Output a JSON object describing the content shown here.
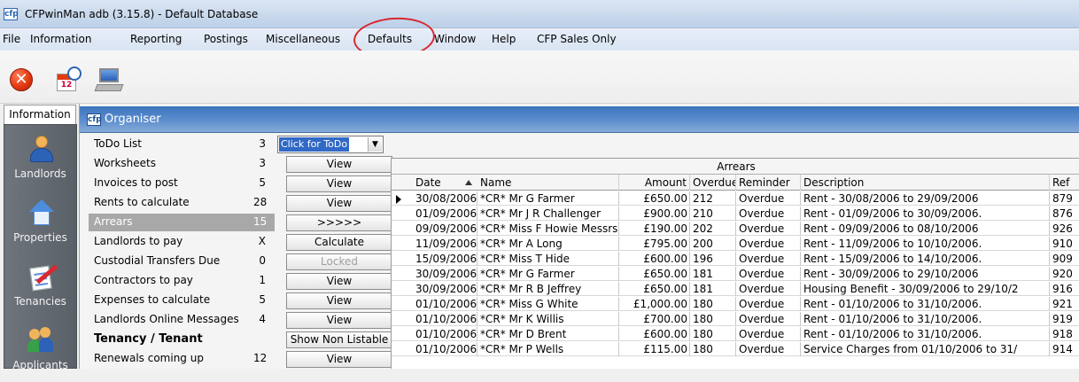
{
  "window": {
    "title": "CFPwinMan adb (3.15.8) - Default Database",
    "logo": "cfp"
  },
  "menu": [
    "File",
    "Information",
    "Reporting",
    "Postings",
    "Miscellaneous",
    "Defaults",
    "Window",
    "Help",
    "CFP Sales Only"
  ],
  "toolbar": {
    "icons": [
      "exit-icon",
      "calendar-icon",
      "computer-icon"
    ],
    "calendar_day": "12"
  },
  "leftnav": {
    "tab": "Information",
    "items": [
      {
        "label": "Landlords",
        "icon": "landlord-icon"
      },
      {
        "label": "Properties",
        "icon": "house-icon"
      },
      {
        "label": "Tenancies",
        "icon": "tenancy-icon"
      },
      {
        "label": "Applicants",
        "icon": "applicants-icon"
      }
    ]
  },
  "organiser": {
    "title": "Organiser",
    "logo": "cfp",
    "todo_combo": "Click for ToDo",
    "rows": [
      {
        "label": "ToDo List",
        "count": "3"
      },
      {
        "label": "Worksheets",
        "count": "3",
        "button": "View"
      },
      {
        "label": "Invoices to post",
        "count": "5",
        "button": "View"
      },
      {
        "label": "Rents to calculate",
        "count": "28",
        "button": "View"
      },
      {
        "label": "Arrears",
        "count": "15",
        "button": ">>>>>",
        "selected": true
      },
      {
        "label": "Landlords to pay",
        "count": "X",
        "button": "Calculate"
      },
      {
        "label": "Custodial Transfers Due",
        "count": "0",
        "button": "Locked",
        "disabled": true
      },
      {
        "label": "Contractors to pay",
        "count": "1",
        "button": "View"
      },
      {
        "label": "Expenses to calculate",
        "count": "5",
        "button": "View"
      },
      {
        "label": "Landlords Online Messages",
        "count": "4",
        "button": "View"
      },
      {
        "label": "Tenancy / Tenant",
        "count": "",
        "button": "Show Non Listable",
        "bold": true
      },
      {
        "label": "Renewals coming up",
        "count": "12",
        "button": "View"
      }
    ]
  },
  "arrears": {
    "caption": "Arrears",
    "columns": [
      "Date",
      "Name",
      "Amount",
      "Overdue",
      "Reminder",
      "Description",
      "Ref"
    ],
    "rows": [
      [
        "30/08/2006",
        "*CR* Mr G Farmer",
        "£650.00",
        "212",
        "Overdue",
        "Rent - 30/08/2006 to 29/09/2006",
        "879"
      ],
      [
        "01/09/2006",
        "*CR* Mr J R Challenger",
        "£900.00",
        "210",
        "Overdue",
        "Rent - 01/09/2006 to 30/09/2006.",
        "876"
      ],
      [
        "09/09/2006",
        "*CR* Miss F Howie Messrs",
        "£190.00",
        "202",
        "Overdue",
        "Rent - 09/09/2006 to 08/10/2006",
        "926"
      ],
      [
        "11/09/2006",
        "*CR* Mr A Long",
        "£795.00",
        "200",
        "Overdue",
        "Rent - 11/09/2006 to 10/10/2006.",
        "910"
      ],
      [
        "15/09/2006",
        "*CR* Miss T Hide",
        "£600.00",
        "196",
        "Overdue",
        "Rent - 15/09/2006 to 14/10/2006.",
        "909"
      ],
      [
        "30/09/2006",
        "*CR* Mr G Farmer",
        "£650.00",
        "181",
        "Overdue",
        "Rent - 30/09/2006 to 29/10/2006",
        "920"
      ],
      [
        "30/09/2006",
        "*CR* Mr R B Jeffrey",
        "£650.00",
        "181",
        "Overdue",
        "Housing Benefit - 30/09/2006 to 29/10/2",
        "916"
      ],
      [
        "01/10/2006",
        "*CR* Miss G White",
        "£1,000.00",
        "180",
        "Overdue",
        "Rent - 01/10/2006 to 31/10/2006.",
        "921"
      ],
      [
        "01/10/2006",
        "*CR* Mr K Willis",
        "£700.00",
        "180",
        "Overdue",
        "Rent - 01/10/2006 to 31/10/2006.",
        "919"
      ],
      [
        "01/10/2006",
        "*CR* Mr D Brent",
        "£600.00",
        "180",
        "Overdue",
        "Rent - 01/10/2006 to 31/10/2006.",
        "918"
      ],
      [
        "01/10/2006",
        "*CR* Mr P Wells",
        "£115.00",
        "180",
        "Overdue",
        "Service Charges from 01/10/2006 to 31/",
        "914"
      ]
    ]
  },
  "colors": {
    "annotation_circle": "#d9282f",
    "organiser_header": "#3d74bd",
    "nav_panel": "#5f656c"
  }
}
